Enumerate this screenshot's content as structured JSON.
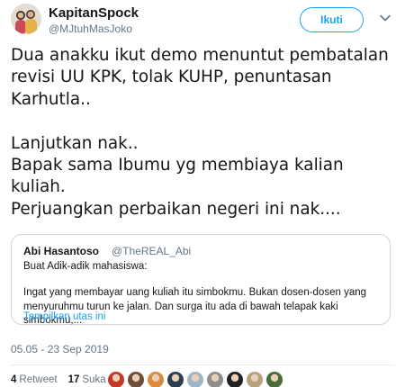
{
  "author": {
    "name": "KapitanSpock",
    "handle": "@MJtuhMasJoko"
  },
  "actions": {
    "follow_label": "Ikuti",
    "more_icon": "chevron-down-icon"
  },
  "tweet": {
    "text": "Dua anakku ikut demo menuntut pembatalan revisi UU KPK, tolak KUHP, penuntasan Karhutla..\n\nLanjutkan nak..\nBapak sama Ibumu yg membiaya kalian kuliah.\nPerjuangkan perbaikan negeri ini nak...."
  },
  "quoted_tweet": {
    "name": "Abi Hasantoso",
    "handle": "@TheREAL_Abi",
    "first_line": "Buat Adik-adik mahasiswa:",
    "body": "Ingat yang membayar uang kuliah itu simbokmu. Bukan dosen-dosen yang menyuruhmu turun ke jalan. Dan surga itu ada di bawah telapak kaki simbokmu,...",
    "show_thread": "Tampilkan utas ini"
  },
  "timestamp": "05.05 - 23 Sep 2019",
  "stats": {
    "retweets_count": "4",
    "retweets_label": "Retweet",
    "likes_count": "17",
    "likes_label": "Suka"
  },
  "likers": [
    {
      "color": "#c0392b"
    },
    {
      "color": "#6b4f3a"
    },
    {
      "color": "#d98c3f"
    },
    {
      "color": "#2c3e50"
    },
    {
      "color": "#9fb6c8"
    },
    {
      "color": "#8e8e8e"
    },
    {
      "color": "#222222"
    },
    {
      "color": "#b7a27c"
    },
    {
      "color": "#4a6b3c"
    }
  ],
  "colors": {
    "accent": "#1da1f2",
    "text": "#14171a",
    "muted": "#657786",
    "border": "#ccd6dd"
  }
}
